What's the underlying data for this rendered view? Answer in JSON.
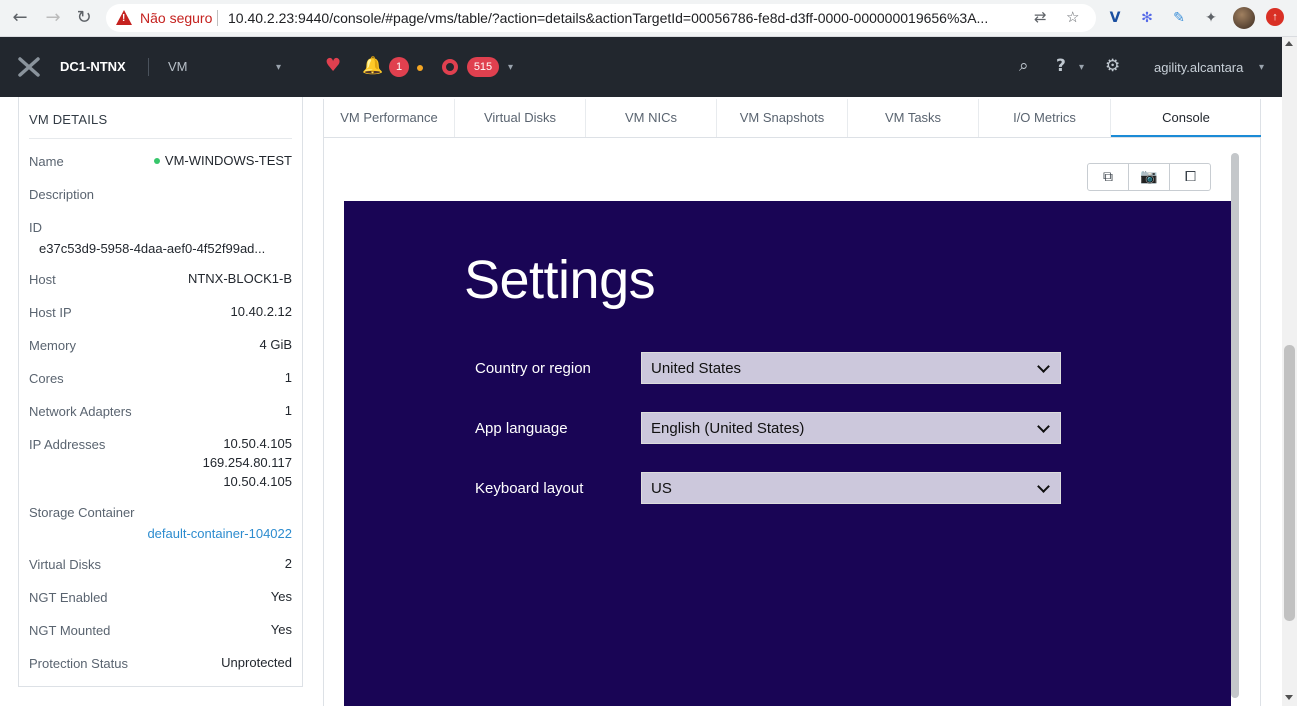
{
  "browser": {
    "insecure_label": "Não seguro",
    "url": "10.40.2.23:9440/console/#page/vms/table/?action=details&actionTargetId=00056786-fe8d-d3ff-0000-000000019656%3A...",
    "update_label": "↑"
  },
  "header": {
    "cluster_name": "DC1-NTNX",
    "entity": "VM",
    "alerts_count": "1",
    "tasks_count": "515",
    "username": "agility.alcantara"
  },
  "vm_details": {
    "title": "VM DETAILS",
    "fields": [
      {
        "label": "Name",
        "value": "VM-WINDOWS-TEST"
      },
      {
        "label": "Description",
        "value": ""
      },
      {
        "label": "ID",
        "value": "e37c53d9-5958-4daa-aef0-4f52f99ad..."
      },
      {
        "label": "Host",
        "value": "NTNX-BLOCK1-B"
      },
      {
        "label": "Host IP",
        "value": "10.40.2.12"
      },
      {
        "label": "Memory",
        "value": "4 GiB"
      },
      {
        "label": "Cores",
        "value": "1"
      },
      {
        "label": "Network Adapters",
        "value": "1"
      },
      {
        "label": "IP Addresses",
        "value": [
          "10.50.4.105",
          "169.254.80.117",
          "10.50.4.105"
        ]
      },
      {
        "label": "Storage Container",
        "value": "default-container-104022"
      },
      {
        "label": "Virtual Disks",
        "value": "2"
      },
      {
        "label": "NGT Enabled",
        "value": "Yes"
      },
      {
        "label": "NGT Mounted",
        "value": "Yes"
      },
      {
        "label": "Protection Status",
        "value": "Unprotected"
      }
    ]
  },
  "tabs": [
    "VM Performance",
    "Virtual Disks",
    "VM NICs",
    "VM Snapshots",
    "VM Tasks",
    "I/O Metrics",
    "Console"
  ],
  "active_tab": "Console",
  "console": {
    "screen_title": "Settings",
    "rows": [
      {
        "label": "Country or region",
        "value": "United States"
      },
      {
        "label": "App language",
        "value": "English (United States)"
      },
      {
        "label": "Keyboard layout",
        "value": "US"
      }
    ]
  },
  "colors": {
    "header_bg": "#22272e",
    "accent": "#1b8bd6",
    "alert": "#e0404f",
    "windows_bg": "#190555"
  }
}
